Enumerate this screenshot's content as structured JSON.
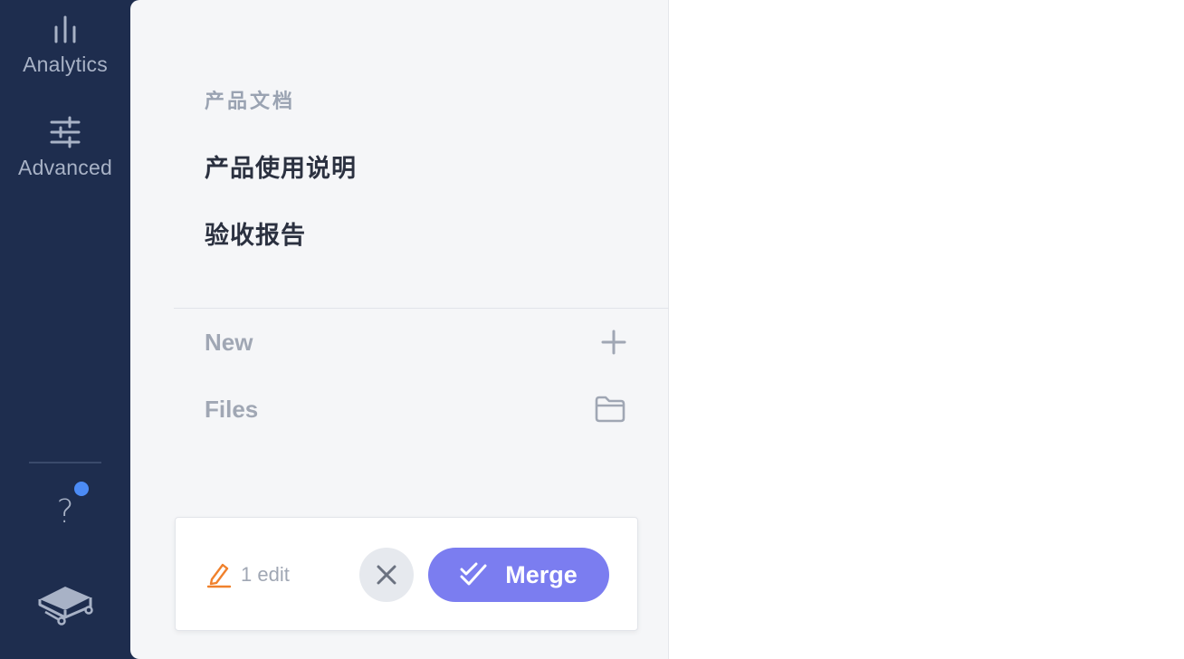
{
  "rail": {
    "items": [
      {
        "label": "Analytics",
        "icon": "bar-chart-icon"
      },
      {
        "label": "Advanced",
        "icon": "sliders-icon"
      }
    ],
    "help_icon": "question-mark-icon",
    "help_glyph": "?",
    "notification_color": "#4c8bf5",
    "logo_icon": "book-logo-icon"
  },
  "panel": {
    "section_title": "产品文档",
    "documents": [
      {
        "label": "产品使用说明"
      },
      {
        "label": "验收报告"
      }
    ],
    "actions": [
      {
        "label": "New",
        "icon": "plus-icon"
      },
      {
        "label": "Files",
        "icon": "folder-icon"
      }
    ]
  },
  "edit_card": {
    "edit_count": "1 edit",
    "edit_icon": "pencil-icon",
    "edit_icon_color": "#f0812c",
    "close_icon": "close-icon",
    "merge_label": "Merge",
    "merge_icon": "double-check-icon",
    "merge_color": "#7b7df0"
  },
  "colors": {
    "rail_bg": "#1e2d4e",
    "panel_bg": "#f5f6f8"
  }
}
